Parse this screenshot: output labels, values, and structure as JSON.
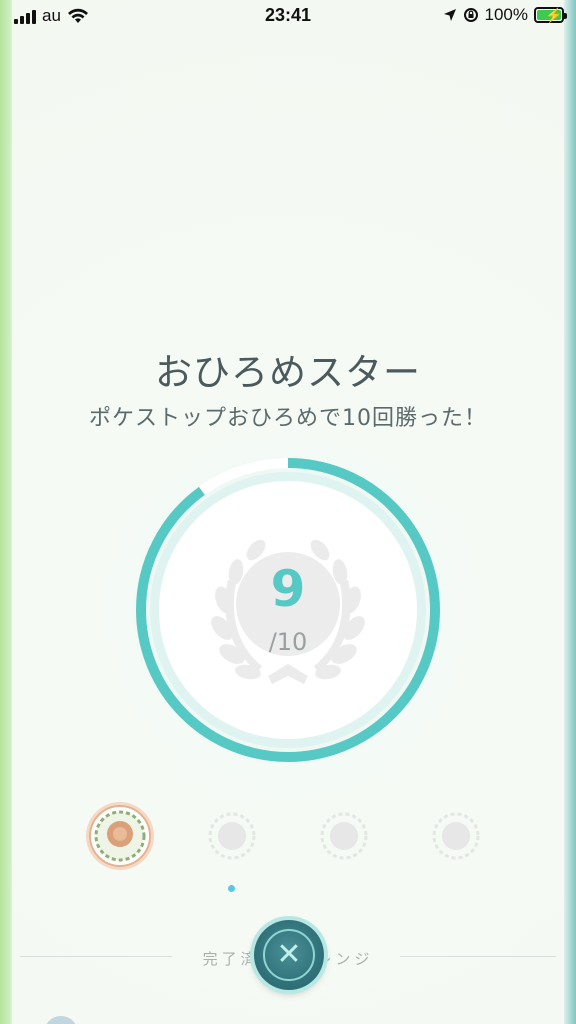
{
  "status_bar": {
    "carrier": "au",
    "time": "23:41",
    "battery_percent": "100%"
  },
  "challenge": {
    "title": "おひろめスター",
    "description": "ポケストップおひろめで10回勝った！",
    "current": "9",
    "total": "/10",
    "progress_fraction": 0.9
  },
  "medals": {
    "selected_index": 0,
    "count": 4
  },
  "completed_section": {
    "label": "完了済みチャレンジ"
  },
  "colors": {
    "accent": "#57c9c4",
    "ring_bg": "#d9f2ef",
    "close_button": "#2e6e76"
  }
}
